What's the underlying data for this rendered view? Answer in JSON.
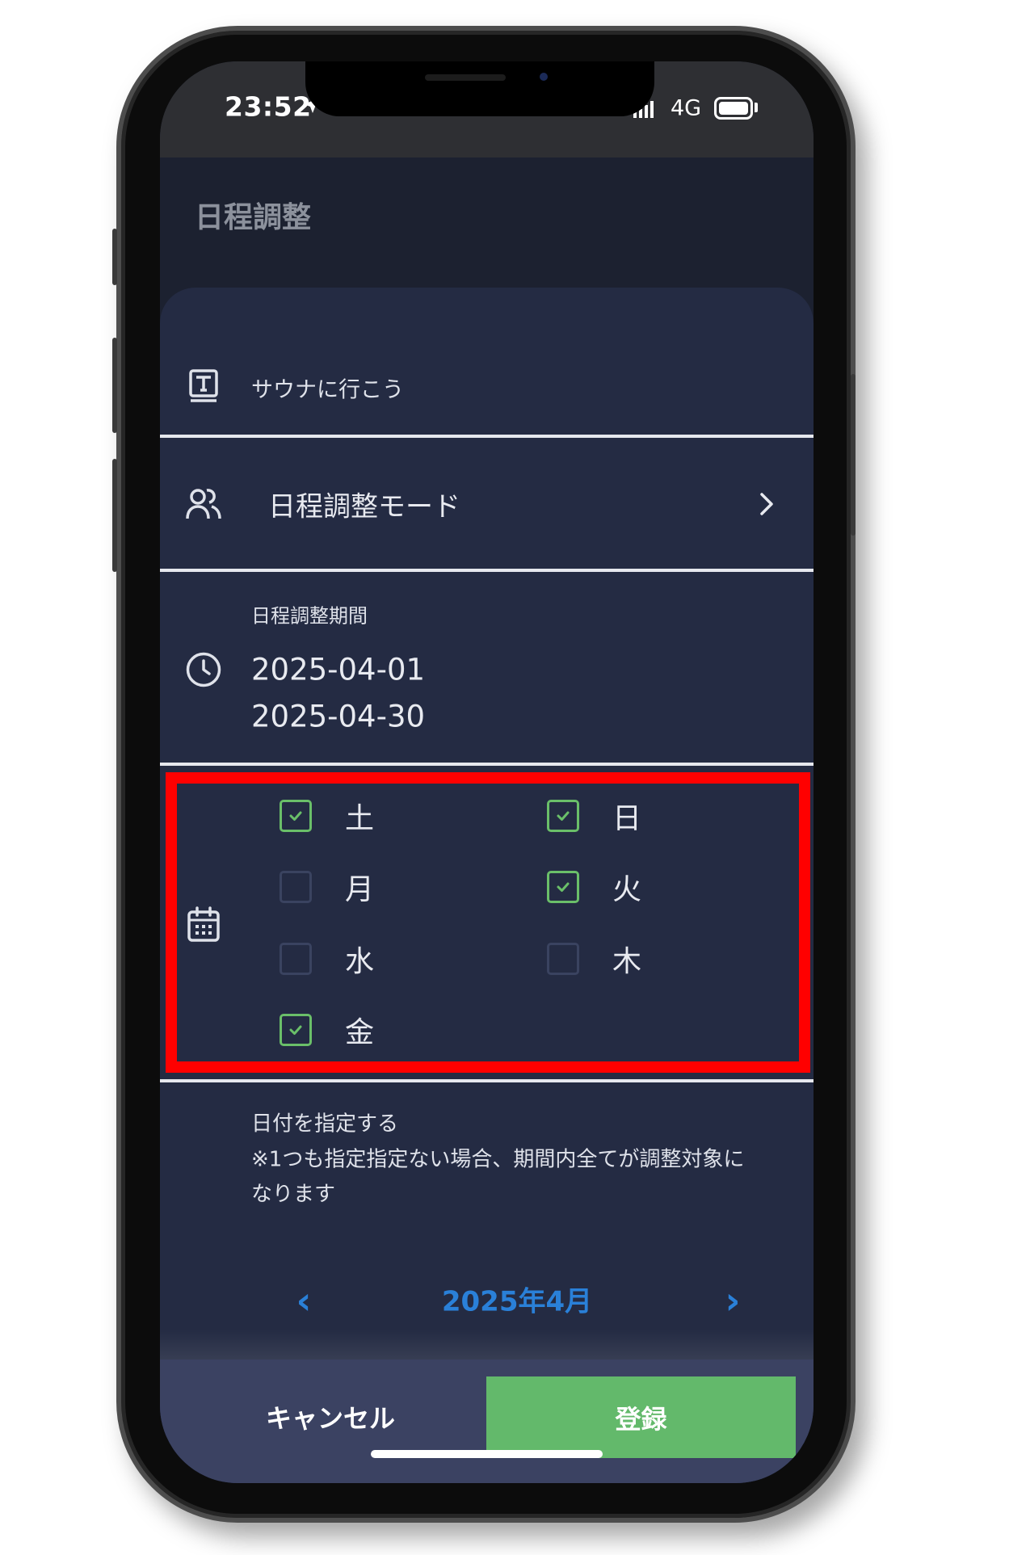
{
  "status_bar": {
    "time": "23:52",
    "network": "4G"
  },
  "header": {
    "title": "日程調整"
  },
  "form": {
    "event_title": "サウナに行こう",
    "mode_label": "日程調整モード",
    "period": {
      "label": "日程調整期間",
      "start": "2025-04-01",
      "end": "2025-04-30"
    },
    "weekdays": [
      {
        "label": "土",
        "checked": true
      },
      {
        "label": "日",
        "checked": true
      },
      {
        "label": "月",
        "checked": false
      },
      {
        "label": "火",
        "checked": true
      },
      {
        "label": "水",
        "checked": false
      },
      {
        "label": "木",
        "checked": false
      },
      {
        "label": "金",
        "checked": true
      }
    ],
    "date_note": {
      "title": "日付を指定する",
      "lines": [
        "※1つも指定指定ない場合、期間内全てが調整対象に",
        "なります"
      ]
    }
  },
  "calendar": {
    "prev": "‹",
    "month_label": "2025年4月",
    "next": "›"
  },
  "footer": {
    "cancel_label": "キャンセル",
    "register_label": "登録"
  },
  "icons": {
    "status": [
      "location-arrow-icon",
      "signal-icon",
      "battery-icon"
    ],
    "rows": [
      "title-icon",
      "people-icon",
      "chevron-right-icon",
      "clock-icon",
      "calendar-icon",
      "check-icon"
    ]
  },
  "colors": {
    "highlight_border": "#ff0000",
    "accent_blue": "#2a80d8",
    "register_green": "#63b96b",
    "check_green": "#6abf69",
    "card_bg": "#242b43",
    "footer_bg": "#3b4262"
  }
}
